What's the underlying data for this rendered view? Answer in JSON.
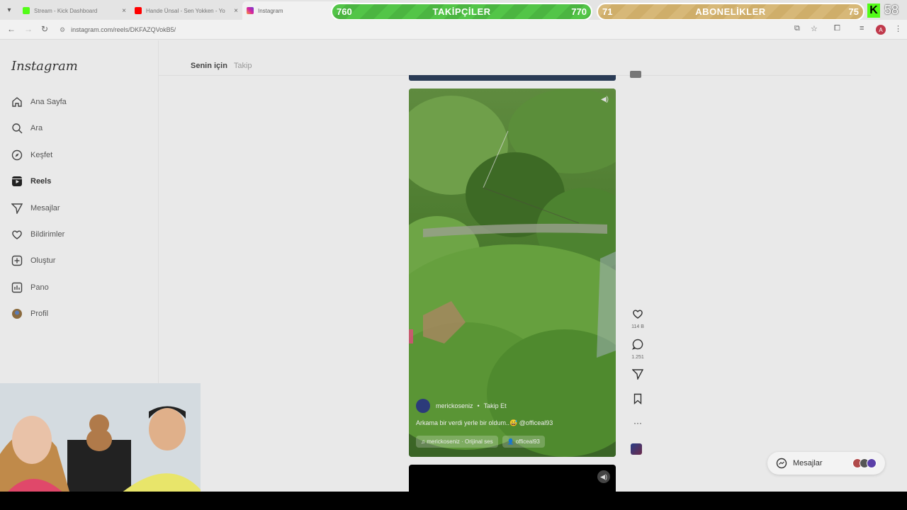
{
  "browser": {
    "tabs": [
      {
        "title": "Stream - Kick Dashboard",
        "color": "#53fc18"
      },
      {
        "title": "Hande Ünsal - Sen Yokken - Yo",
        "color": "#ff0000"
      },
      {
        "title": "Instagram",
        "color": "#d6249f",
        "active": true
      }
    ],
    "url": "instagram.com/reels/DKFAZQVokB5/",
    "close_glyph": "×"
  },
  "overlay": {
    "followers": {
      "left": "760",
      "label": "TAKİPÇİLER",
      "right": "770"
    },
    "subscribers": {
      "left": "71",
      "label": "ABONELİKLER",
      "right": "75"
    },
    "kick_logo": "K",
    "kick_count": "58"
  },
  "sidebar": {
    "logo": "Instagram",
    "items": [
      {
        "label": "Ana Sayfa",
        "icon": "home-icon"
      },
      {
        "label": "Ara",
        "icon": "search-icon"
      },
      {
        "label": "Keşfet",
        "icon": "compass-icon"
      },
      {
        "label": "Reels",
        "icon": "reels-icon",
        "active": true
      },
      {
        "label": "Mesajlar",
        "icon": "send-icon"
      },
      {
        "label": "Bildirimler",
        "icon": "heart-icon"
      },
      {
        "label": "Oluştur",
        "icon": "plus-icon"
      },
      {
        "label": "Pano",
        "icon": "dashboard-icon"
      },
      {
        "label": "Profil",
        "icon": "profile-icon"
      }
    ]
  },
  "feed_tabs": {
    "for_you": "Senin için",
    "following": "Takip"
  },
  "reel": {
    "username": "merickoseniz",
    "follow": "Takip Et",
    "caption": "Arkama bir verdi yerle bir oldum..😅 @officeal93",
    "audio": "merickoseniz · Orijinal ses",
    "tagged": "officeal93",
    "likes": "114 B",
    "comments": "1.251"
  },
  "messages": {
    "label": "Mesajlar"
  },
  "colors": {
    "green_bar": "#53c548",
    "gold_bar": "#d7b878",
    "kick": "#53fc18"
  }
}
